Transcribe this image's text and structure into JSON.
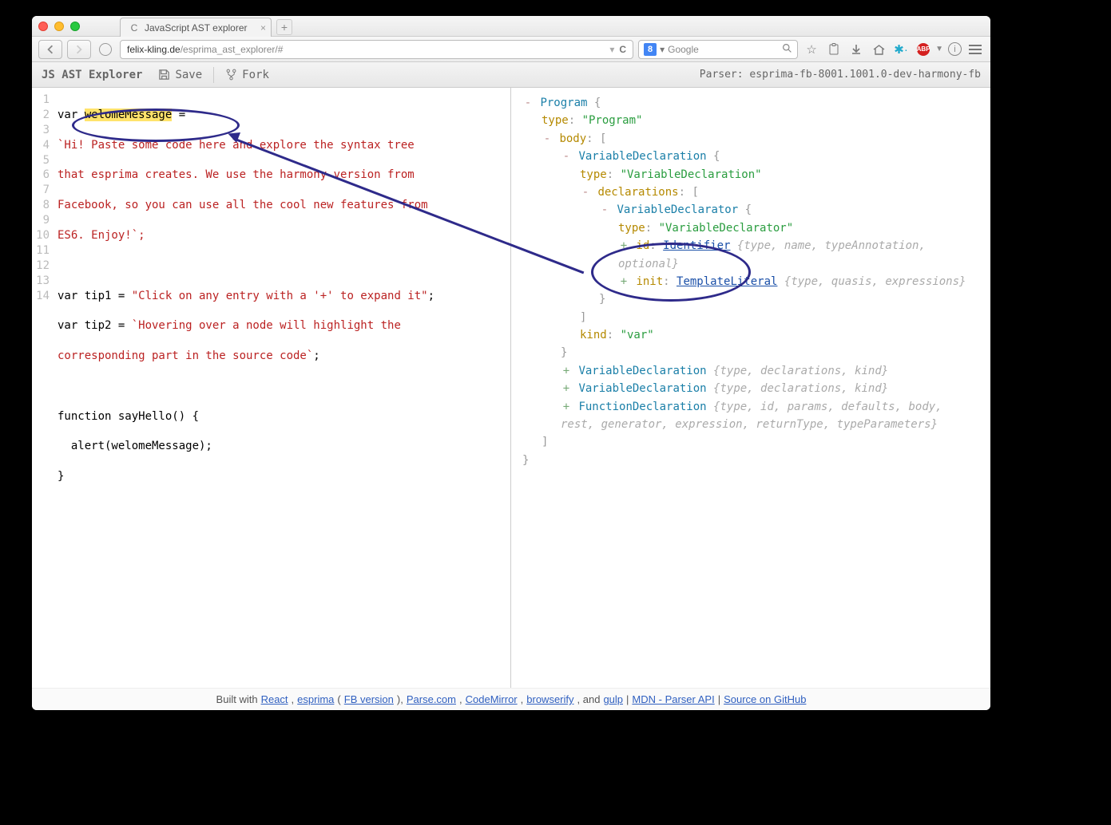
{
  "browser": {
    "tab_title": "JavaScript AST explorer",
    "url_host": "felix-kling.de",
    "url_path": "/esprima_ast_explorer/#",
    "search_placeholder": "Google"
  },
  "appbar": {
    "title": "JS AST Explorer",
    "save": "Save",
    "fork": "Fork",
    "parser": "Parser: esprima-fb-8001.1001.0-dev-harmony-fb"
  },
  "code": {
    "line_numbers": [
      "1",
      "2",
      "3",
      "4",
      "5",
      "6",
      "7",
      "8",
      "9",
      "10",
      "11",
      "12",
      "13",
      "14"
    ],
    "l1_a": "var ",
    "l1_hl": "welomeMessage",
    "l1_b": " =",
    "l2": "`Hi! Paste some code here and explore the syntax tree",
    "l3": "that esprima creates. We use the harmony version from",
    "l4": "Facebook, so you can use all the cool new features from",
    "l5": "ES6. Enjoy!`;",
    "l7a": "var tip1 = ",
    "l7b": "\"Click on any entry with a '+' to expand it\"",
    "l7c": ";",
    "l8a": "var tip2 = ",
    "l8b": "`Hovering over a node will highlight the",
    "l9": "corresponding part in the source code`",
    "l9b": ";",
    "l11": "function sayHello() {",
    "l12": "  alert(welomeMessage);",
    "l13": "}"
  },
  "ast": {
    "root": "Program",
    "type_lbl": "type",
    "type_program": "\"Program\"",
    "body_lbl": "body",
    "vd": "VariableDeclaration",
    "type_vd": "\"VariableDeclaration\"",
    "decls_lbl": "declarations",
    "vdr": "VariableDeclarator",
    "type_vdr": "\"VariableDeclarator\"",
    "id_lbl": "id",
    "identifier": "Identifier",
    "id_hint": "{type, name, typeAnnotation, optional}",
    "init_lbl": "init",
    "tmpl": "TemplateLiteral",
    "tmpl_hint": "{type, quasis, expressions}",
    "kind_lbl": "kind",
    "kind_val": "\"var\"",
    "vd_hint": "{type, declarations, kind}",
    "fd": "FunctionDeclaration",
    "fd_hint": "{type, id, params, defaults, body, rest, generator, expression, returnType, typeParameters}"
  },
  "footer": {
    "prefix": "Built with ",
    "react": "React",
    "sep1": ", ",
    "esprima": "esprima",
    "paren_l": " (",
    "fb": "FB version",
    "paren_r": "), ",
    "parse": "Parse.com",
    "sep2": ", ",
    "cm": "CodeMirror",
    "sep3": ", ",
    "browserify": "browserify",
    "and_gulp": ", and ",
    "gulp": "gulp",
    "pipe1": " | ",
    "mdn": "MDN - Parser API",
    "pipe2": " | ",
    "src": "Source on GitHub"
  }
}
